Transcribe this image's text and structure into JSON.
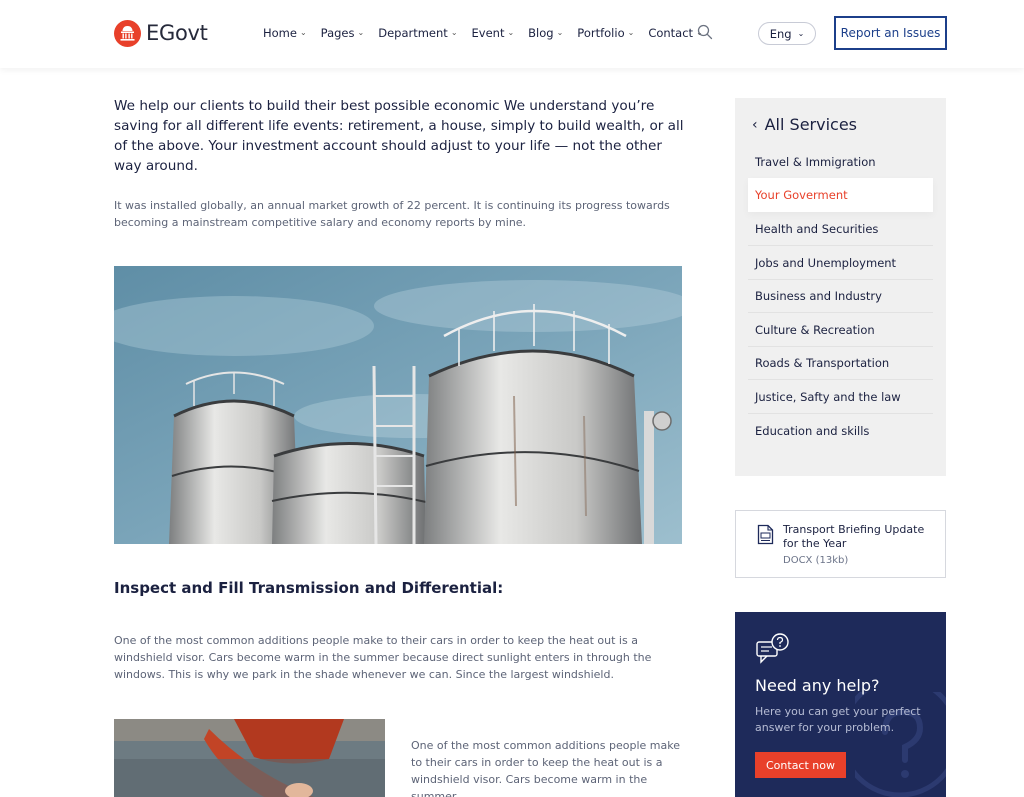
{
  "header": {
    "logo_text": "EGovt",
    "nav": [
      {
        "label": "Home"
      },
      {
        "label": "Pages"
      },
      {
        "label": "Department"
      },
      {
        "label": "Event"
      },
      {
        "label": "Blog"
      },
      {
        "label": "Portfolio"
      },
      {
        "label": "Contact"
      }
    ],
    "language": "Eng",
    "report_button": "Report an Issues"
  },
  "content": {
    "intro": "We help our clients to build their best possible economic We understand you’re saving for all different life events: retirement, a house, simply to build wealth, or all of the above. Your investment account should adjust to your life — not the other way around.",
    "paragraph_1": "It was installed globally, an annual market growth of 22 percent. It is continuing its progress towards becoming a mainstream competitive salary and economy reports by mine.",
    "section_title": "Inspect and Fill Transmission and Differential:",
    "paragraph_2": "One of the most common additions people make to their cars in order to keep the heat out is a windshield visor. Cars become warm in the summer because direct sunlight enters in through the windows. This is why we park in the shade whenever we can. Since the largest windshield.",
    "paragraph_3": "One of the most common additions people make to their cars in order to keep the heat out is a windshield visor. Cars become warm in the summer."
  },
  "sidebar": {
    "services_title": "All Services",
    "services": [
      {
        "label": "Travel & Immigration",
        "active": false
      },
      {
        "label": "Your Goverment",
        "active": true
      },
      {
        "label": "Health and Securities",
        "active": false
      },
      {
        "label": "Jobs and Unemployment",
        "active": false
      },
      {
        "label": "Business and Industry",
        "active": false
      },
      {
        "label": "Culture & Recreation",
        "active": false
      },
      {
        "label": "Roads & Transportation",
        "active": false
      },
      {
        "label": "Justice, Safty and the law",
        "active": false
      },
      {
        "label": "Education and skills",
        "active": false
      }
    ],
    "document": {
      "title": "Transport Briefing Update for the Year",
      "meta": "DOCX (13kb)"
    },
    "help": {
      "title": "Need any help?",
      "text": "Here you can get your perfect answer for your problem.",
      "button": "Contact now"
    }
  },
  "colors": {
    "accent": "#e8402a",
    "navy": "#1e2a5a",
    "button_border": "#1c3f8a"
  }
}
